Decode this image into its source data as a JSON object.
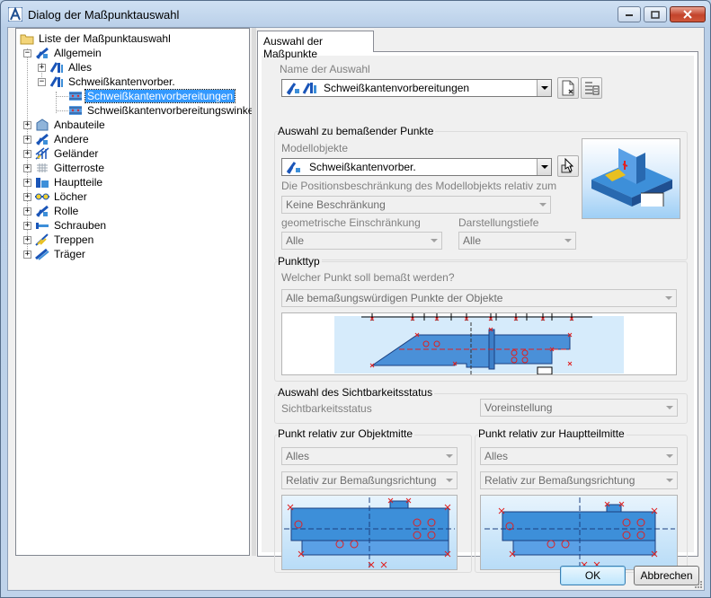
{
  "window": {
    "title": "Dialog der Maßpunktauswahl"
  },
  "colors": {
    "selection": "#3399ff",
    "accent_blue": "#3d8fd9",
    "marker_red": "#e02020"
  },
  "tree": {
    "root": "Liste der Maßpunktauswahl",
    "items": [
      {
        "label": "Allgemein",
        "icon": "general-icon"
      },
      {
        "label": "Alles",
        "icon": "all-icon"
      },
      {
        "label": "Schweißkantenvorber.",
        "icon": "weld-prep-icon"
      },
      {
        "label": "Schweißkantenvorbereitungen",
        "icon": "weld-selection-icon",
        "selected": true
      },
      {
        "label": "Schweißkantenvorbereitungswinkel",
        "icon": "weld-selection-icon"
      },
      {
        "label": "Anbauteile",
        "icon": "attachment-icon"
      },
      {
        "label": "Andere",
        "icon": "other-icon"
      },
      {
        "label": "Geländer",
        "icon": "railing-icon"
      },
      {
        "label": "Gitterroste",
        "icon": "grating-icon"
      },
      {
        "label": "Hauptteile",
        "icon": "main-part-icon"
      },
      {
        "label": "Löcher",
        "icon": "holes-icon"
      },
      {
        "label": "Rolle",
        "icon": "roll-icon"
      },
      {
        "label": "Schrauben",
        "icon": "bolt-icon"
      },
      {
        "label": "Treppen",
        "icon": "stairs-icon"
      },
      {
        "label": "Träger",
        "icon": "beam-icon"
      }
    ]
  },
  "tab": {
    "label": "Auswahl der Maßpunkte"
  },
  "selection_name": {
    "label": "Name der Auswahl",
    "value": "Schweißkantenvorbereitungen"
  },
  "points_group": {
    "title": "Auswahl zu bemaßender Punkte",
    "model_objects_label": "Modellobjekte",
    "model_objects_value": "Schweißkantenvorber.",
    "position_label": "Die Positionsbeschränkung des Modellobjekts relativ zum",
    "position_value": "Keine Beschränkung",
    "geo_label": "geometrische Einschränkung",
    "geo_value": "Alle",
    "depth_label": "Darstellungstiefe",
    "depth_value": "Alle"
  },
  "point_type": {
    "title": "Punkttyp",
    "question": "Welcher Punkt soll bemaßt werden?",
    "value": "Alle bemaßungswürdigen Punkte der Objekte"
  },
  "visibility": {
    "title": "Auswahl des Sichtbarkeitsstatus",
    "label": "Sichtbarkeitsstatus",
    "value": "Voreinstellung"
  },
  "relative_object": {
    "title": "Punkt relativ zur Objektmitte",
    "value1": "Alles",
    "value2": "Relativ zur Bemaßungsrichtung"
  },
  "relative_main": {
    "title": "Punkt relativ zur Hauptteilmitte",
    "value1": "Alles",
    "value2": "Relativ zur Bemaßungsrichtung"
  },
  "buttons": {
    "ok": "OK",
    "cancel": "Abbrechen"
  }
}
